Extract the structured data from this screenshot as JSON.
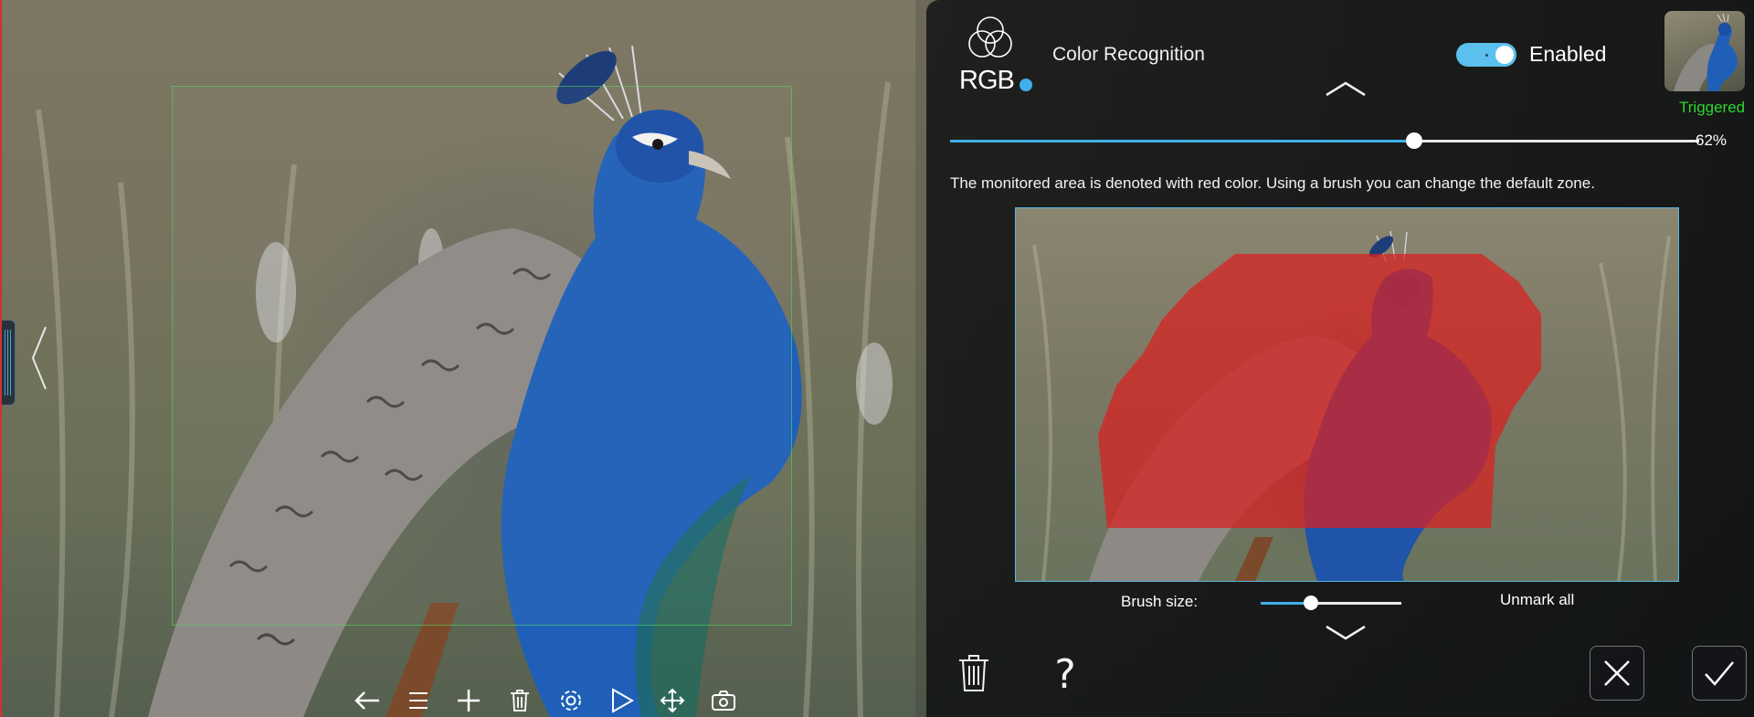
{
  "panel": {
    "logo_text": "RGB",
    "title": "Color Recognition",
    "toggle": {
      "state": true,
      "label": "Enabled"
    },
    "thumbnail_status": "Triggered",
    "sensitivity": {
      "value": 0.62,
      "label": "62%"
    },
    "description": "The monitored area is denoted with red color. Using a brush you can change the default zone.",
    "brush": {
      "label": "Brush size:",
      "value": 0.36
    },
    "unmark_label": "Unmark all"
  },
  "colors": {
    "accent": "#3fb0ea",
    "triggered": "#2fd62f",
    "mask": "#dc1e1e",
    "roi": "#50dc5a"
  },
  "toolbar": {
    "icons": [
      "back-arrow-icon",
      "list-icon",
      "plus-icon",
      "trash-icon",
      "gear-icon",
      "play-icon",
      "move-icon",
      "camera-icon"
    ]
  }
}
